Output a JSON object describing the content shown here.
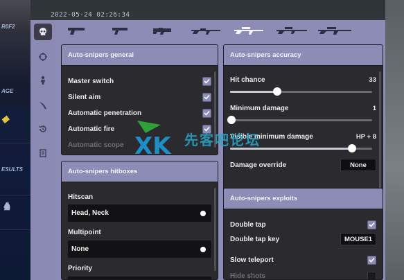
{
  "timestamp": "2022-05-24 02:26:34",
  "background": {
    "banners": [
      "R0F2",
      "AGE",
      "",
      "ESULTS",
      "",
      "",
      ""
    ]
  },
  "sidebar": {
    "icons": [
      "skull-icon",
      "crosshair-icon",
      "player-icon",
      "knife-icon",
      "history-icon",
      "script-icon"
    ]
  },
  "weapon_tabs": [
    "pistol-icon",
    "deagle-icon",
    "smg-icon",
    "rifle-icon",
    "auto-sniper-icon",
    "scout-icon",
    "awp-icon"
  ],
  "general": {
    "title": "Auto-snipers general",
    "items": [
      {
        "label": "Master switch",
        "checked": true
      },
      {
        "label": "Silent aim",
        "checked": true
      },
      {
        "label": "Automatic penetration",
        "checked": true
      },
      {
        "label": "Automatic fire",
        "checked": true
      },
      {
        "label": "Automatic scope",
        "checked": false
      }
    ]
  },
  "hitboxes": {
    "title": "Auto-snipers hitboxes",
    "hitscan_label": "Hitscan",
    "hitscan_value": "Head, Neck",
    "multipoint_label": "Multipoint",
    "multipoint_value": "None",
    "priority_label": "Priority"
  },
  "accuracy": {
    "title": "Auto-snipers accuracy",
    "hit_chance_label": "Hit chance",
    "hit_chance_value": "33",
    "hit_chance_fraction": 0.33,
    "min_damage_label": "Minimum damage",
    "min_damage_value": "1",
    "min_damage_fraction": 0.01,
    "visible_min_damage_label": "Visible minimum damage",
    "visible_min_damage_value": "HP + 8",
    "visible_min_damage_fraction": 0.86,
    "damage_override_label": "Damage override",
    "damage_override_value": "None"
  },
  "exploits": {
    "title": "Auto-snipers exploits",
    "double_tap_label": "Double tap",
    "double_tap_checked": true,
    "double_tap_key_label": "Double tap key",
    "double_tap_key_value": "MOUSE1",
    "slow_teleport_label": "Slow teleport",
    "slow_teleport_checked": true,
    "hide_shots_label": "Hide shots",
    "hide_shots_checked": false
  },
  "watermark": {
    "logo": "XK",
    "text": "先客吧论坛"
  },
  "colors": {
    "accent": "#8c8cb6",
    "panel": "#2b2b2f",
    "watermark": "#2aa6c8"
  }
}
